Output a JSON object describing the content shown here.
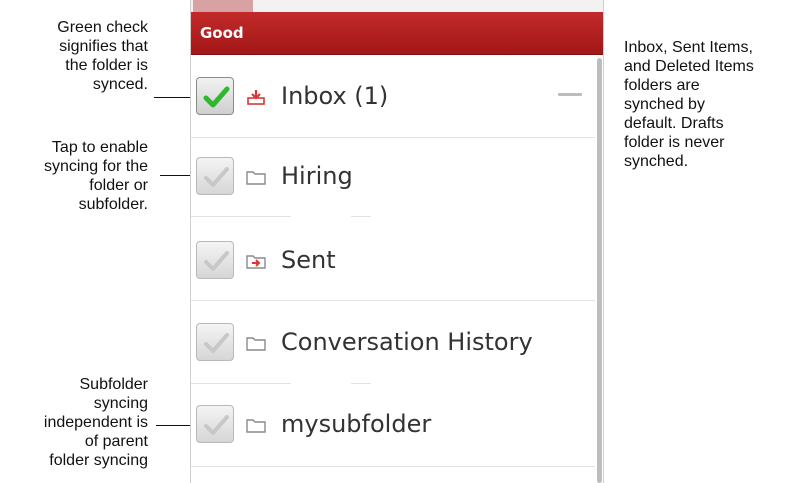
{
  "callouts": {
    "synced_check": [
      "Green check",
      "signifies that",
      "the folder is",
      "synced."
    ],
    "tap_enable": [
      "Tap to enable",
      "syncing for the",
      "folder or",
      "subfolder."
    ],
    "subfolder_independent": [
      "Subfolder",
      "syncing",
      "independent is",
      "of parent",
      "folder syncing"
    ],
    "default_sync": [
      "Inbox, Sent Items,",
      "and Deleted Items",
      "folders are",
      "synched by",
      "default. Drafts",
      "folder is never",
      "synched."
    ]
  },
  "app": {
    "title": "Good"
  },
  "folders": [
    {
      "label": "Inbox (1)",
      "icon": "inbox-download-icon",
      "checked": true
    },
    {
      "label": "Hiring",
      "icon": "folder-icon",
      "checked": false
    },
    {
      "label": "Sent",
      "icon": "sent-folder-icon",
      "checked": false
    },
    {
      "label": "Conversation History",
      "icon": "folder-icon",
      "checked": false
    },
    {
      "label": "mysubfolder",
      "icon": "folder-icon",
      "checked": false
    }
  ],
  "colors": {
    "titlebar": "#b52020",
    "check_green": "#2eb82e",
    "check_gray": "#c8c8c8",
    "icon_red": "#d93636"
  }
}
